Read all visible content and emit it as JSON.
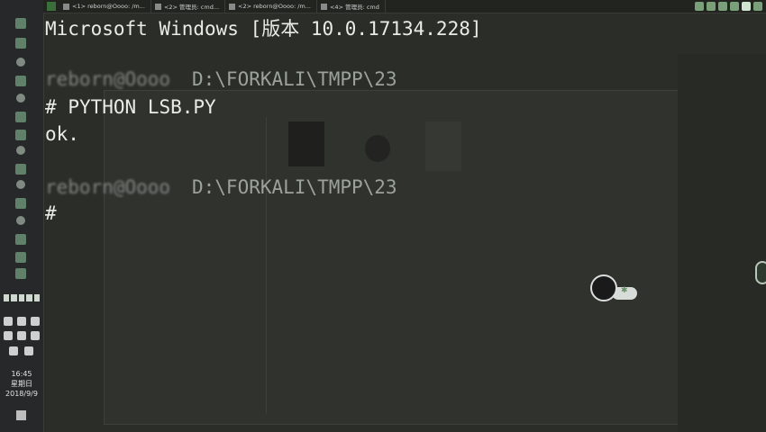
{
  "tabs": [
    {
      "label": "<1> reborn@Oooo: /m..."
    },
    {
      "label": "<2> 管理员: cmd..."
    },
    {
      "label": "<2> reborn@Oooo: /m..."
    },
    {
      "label": "<4> 管理员: cmd"
    }
  ],
  "terminal": {
    "line1": "Microsoft Windows [版本 10.0.17134.228]",
    "prompt_prefix_blurred": "reborn@Oooo",
    "prompt_path": "D:\\FORKALI\\TMPP\\23",
    "cmd_symbol": "#",
    "command": "python LSB.py",
    "output": "ok."
  },
  "clock": {
    "time": "16:45",
    "weekday": "星期日",
    "date": "2018/9/9"
  },
  "colors": {
    "terminal_bg": "#2b2d28",
    "text": "#e9ebe6",
    "accent_green": "#3a6e3a"
  }
}
